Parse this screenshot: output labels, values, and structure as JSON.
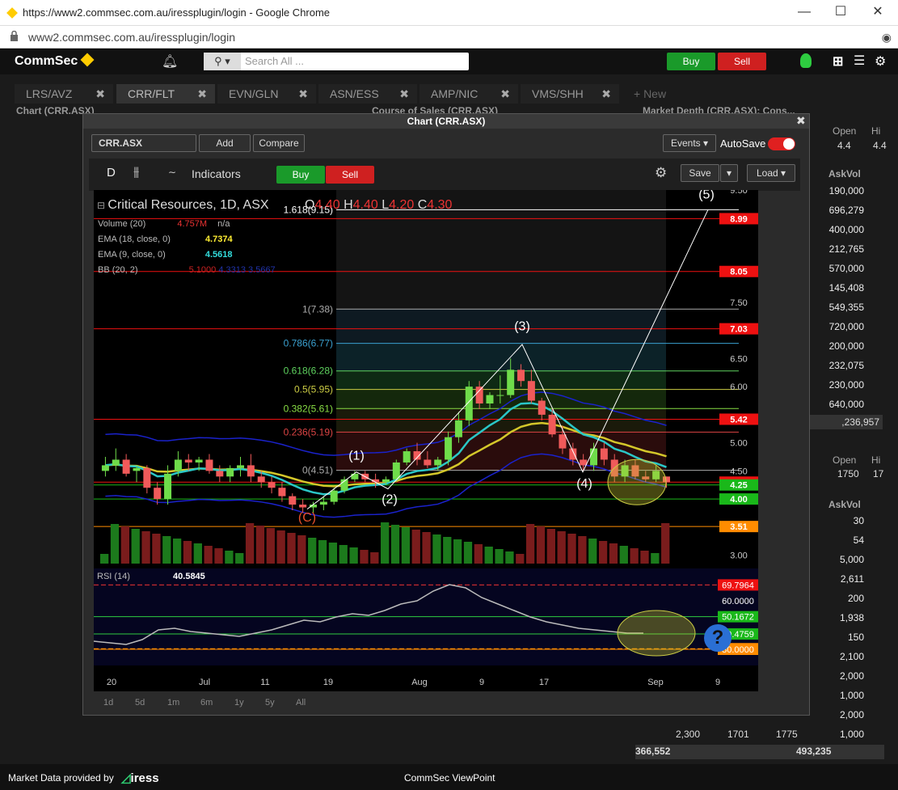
{
  "browser": {
    "title": "https://www2.commsec.com.au/iressplugin/login - Google Chrome",
    "url": "www2.commsec.com.au/iressplugin/login",
    "min": "—",
    "max": "☐",
    "close": "✕"
  },
  "app": {
    "logo": "CommSec",
    "search_placeholder": "Search All ...",
    "buy": "Buy",
    "sell": "Sell",
    "footer_left": "Market Data provided by",
    "footer_brand": "iress",
    "footer_center": "CommSec ViewPoint"
  },
  "tabs": [
    "LRS/AVZ",
    "CRR/FLT",
    "EVN/GLN",
    "ASN/ESS",
    "AMP/NIC",
    "VMS/SHH",
    "+ New"
  ],
  "panels": {
    "chart": "Chart (CRR.ASX)",
    "course": "Course of Sales (CRR.ASX)",
    "depth": "Market Depth (CRR.ASX): Cons..."
  },
  "depth": {
    "open_label": "Open",
    "hi_label": "Hi",
    "open": "4.4",
    "hi": "4.4",
    "askvol_label": "AskVol",
    "askvol": [
      "190,000",
      "696,279",
      "400,000",
      "212,765",
      "570,000",
      "145,408",
      "549,355",
      "720,000",
      "200,000",
      "232,075",
      "230,000",
      "640,000"
    ],
    "total1": ",236,957",
    "open2": "1750",
    "hi2": "17",
    "askvol2": [
      "30",
      "54",
      "5,000",
      "2,611",
      "200",
      "1,938",
      "150",
      "2,100",
      "2,000",
      "1,000",
      "2,000",
      "1,000"
    ],
    "bottom_a": "2,300",
    "bottom_b": "1701",
    "bottom_c": "1775",
    "total2a": "366,552",
    "total2b": "493,235"
  },
  "chart": {
    "window_title": "Chart (CRR.ASX)",
    "symbol": "CRR.ASX",
    "add": "Add",
    "compare": "Compare",
    "events": "Events",
    "autosave": "AutoSave",
    "interval": "D",
    "indicators": "Indicators",
    "buy": "Buy",
    "sell": "Sell",
    "save": "Save",
    "load": "Load",
    "header": "Critical Resources, 1D, ASX",
    "ohlc": {
      "o": "4.40",
      "h": "4.40",
      "l": "4.20",
      "c": "4.30"
    },
    "volume_label": "Volume (20)",
    "volume_val": "4.757M",
    "volume_na": "n/a",
    "ema18_label": "EMA (18, close, 0)",
    "ema18_val": "4.7374",
    "ema9_label": "EMA (9, close, 0)",
    "ema9_val": "4.5618",
    "bb_label": "BB (20, 2)",
    "bb_v1": "5.1000",
    "bb_v2": "4.3313",
    "bb_v3": "3.5667",
    "rsi_label": "RSI (14)",
    "rsi_val": "40.5845",
    "ranges": [
      "1d",
      "5d",
      "1m",
      "6m",
      "1y",
      "5y",
      "All"
    ],
    "xticks": [
      "20",
      "Jul",
      "11",
      "19",
      "Aug",
      "9",
      "17",
      "Sep",
      "9"
    ]
  },
  "chart_data": {
    "type": "candlestick",
    "title": "Critical Resources, 1D, ASX",
    "y_ticks": [
      "9.50",
      "8.99",
      "8.05",
      "7.50",
      "7.03",
      "6.50",
      "6.00",
      "5.42",
      "5.00",
      "4.50",
      "4.30",
      "4.25",
      "4.00",
      "3.51",
      "3.00"
    ],
    "ylim": [
      2.85,
      9.5
    ],
    "fib_levels": [
      {
        "label": "1.618(9.15)",
        "value": 9.15,
        "color": "#ffffff"
      },
      {
        "label": "1(7.38)",
        "value": 7.38,
        "color": "#aaaaaa"
      },
      {
        "label": "0.786(6.77)",
        "value": 6.77,
        "color": "#3aa0d0"
      },
      {
        "label": "0.618(6.28)",
        "value": 6.28,
        "color": "#5fd35f"
      },
      {
        "label": "0.5(5.95)",
        "value": 5.95,
        "color": "#cccc44"
      },
      {
        "label": "0.382(5.61)",
        "value": 5.61,
        "color": "#88dd44"
      },
      {
        "label": "0.236(5.19)",
        "value": 5.19,
        "color": "#dd4444"
      },
      {
        "label": "0(4.51)",
        "value": 4.51,
        "color": "#aaaaaa"
      }
    ],
    "price_badges": [
      {
        "v": "8.99",
        "y": 8.99,
        "color": "#ee1111"
      },
      {
        "v": "8.05",
        "y": 8.05,
        "color": "#ee1111"
      },
      {
        "v": "7.03",
        "y": 7.03,
        "color": "#ee1111"
      },
      {
        "v": "5.42",
        "y": 5.42,
        "color": "#ee1111"
      },
      {
        "v": "4.30",
        "y": 4.3,
        "color": "#ee1111"
      },
      {
        "v": "4.25",
        "y": 4.25,
        "color": "#1ab81a"
      },
      {
        "v": "4.00",
        "y": 4.0,
        "color": "#1ab81a"
      },
      {
        "v": "3.51",
        "y": 3.51,
        "color": "#ff8c00"
      }
    ],
    "waves": [
      "(C)",
      "(1)",
      "(2)",
      "(3)",
      "(4)",
      "(5)"
    ],
    "candles": [
      [
        4.5,
        4.75,
        4.4,
        4.6
      ],
      [
        4.6,
        4.9,
        4.5,
        4.7
      ],
      [
        4.7,
        4.8,
        4.4,
        4.45
      ],
      [
        4.5,
        4.6,
        4.3,
        4.55
      ],
      [
        4.55,
        4.6,
        4.1,
        4.2
      ],
      [
        4.2,
        4.3,
        3.9,
        4.0
      ],
      [
        4.0,
        4.6,
        3.9,
        4.45
      ],
      [
        4.5,
        4.85,
        4.4,
        4.7
      ],
      [
        4.7,
        4.8,
        4.5,
        4.65
      ],
      [
        4.65,
        4.75,
        4.5,
        4.7
      ],
      [
        4.7,
        4.8,
        4.45,
        4.5
      ],
      [
        4.5,
        4.6,
        4.3,
        4.4
      ],
      [
        4.4,
        4.6,
        4.3,
        4.55
      ],
      [
        4.55,
        4.75,
        4.4,
        4.6
      ],
      [
        4.6,
        4.8,
        4.3,
        4.4
      ],
      [
        4.4,
        4.5,
        4.2,
        4.3
      ],
      [
        4.3,
        4.4,
        4.1,
        4.2
      ],
      [
        4.2,
        4.3,
        3.95,
        4.05
      ],
      [
        4.05,
        4.1,
        3.8,
        3.9
      ],
      [
        3.9,
        4.0,
        3.75,
        3.85
      ],
      [
        3.85,
        3.95,
        3.75,
        3.9
      ],
      [
        3.9,
        4.05,
        3.8,
        3.95
      ],
      [
        3.95,
        4.2,
        3.9,
        4.15
      ],
      [
        4.15,
        4.4,
        4.1,
        4.35
      ],
      [
        4.35,
        4.5,
        4.3,
        4.45
      ],
      [
        4.45,
        4.5,
        4.3,
        4.35
      ],
      [
        4.35,
        4.45,
        4.2,
        4.3
      ],
      [
        4.3,
        4.4,
        4.25,
        4.35
      ],
      [
        4.35,
        4.7,
        4.3,
        4.65
      ],
      [
        4.65,
        4.9,
        4.6,
        4.85
      ],
      [
        4.85,
        5.0,
        4.6,
        4.7
      ],
      [
        4.7,
        4.85,
        4.55,
        4.6
      ],
      [
        4.6,
        4.75,
        4.5,
        4.7
      ],
      [
        4.7,
        5.2,
        4.6,
        5.1
      ],
      [
        5.1,
        5.55,
        5.0,
        5.4
      ],
      [
        5.4,
        6.1,
        5.3,
        6.0
      ],
      [
        6.0,
        6.1,
        5.6,
        5.7
      ],
      [
        5.7,
        5.9,
        5.6,
        5.85
      ],
      [
        5.85,
        6.2,
        5.7,
        5.85
      ],
      [
        5.85,
        6.5,
        5.8,
        6.3
      ],
      [
        6.3,
        6.4,
        6.0,
        6.1
      ],
      [
        6.1,
        6.3,
        5.7,
        5.75
      ],
      [
        5.75,
        5.8,
        5.4,
        5.5
      ],
      [
        5.5,
        5.6,
        5.1,
        5.15
      ],
      [
        5.15,
        5.3,
        4.8,
        4.9
      ],
      [
        4.9,
        5.0,
        4.6,
        4.7
      ],
      [
        4.7,
        4.8,
        4.5,
        4.6
      ],
      [
        4.6,
        5.0,
        4.5,
        4.9
      ],
      [
        4.9,
        5.0,
        4.6,
        4.7
      ],
      [
        4.7,
        4.8,
        4.3,
        4.4
      ],
      [
        4.4,
        4.7,
        4.3,
        4.6
      ],
      [
        4.6,
        4.7,
        4.35,
        4.4
      ],
      [
        4.4,
        4.5,
        4.3,
        4.35
      ],
      [
        4.35,
        4.6,
        4.3,
        4.5
      ],
      [
        4.4,
        4.4,
        4.2,
        4.3
      ]
    ],
    "rsi": {
      "value": 40.5845,
      "levels": [
        "69.7964",
        "60.0000",
        "50.1672",
        "39.4759",
        "30.3824",
        "30.0000"
      ]
    }
  }
}
